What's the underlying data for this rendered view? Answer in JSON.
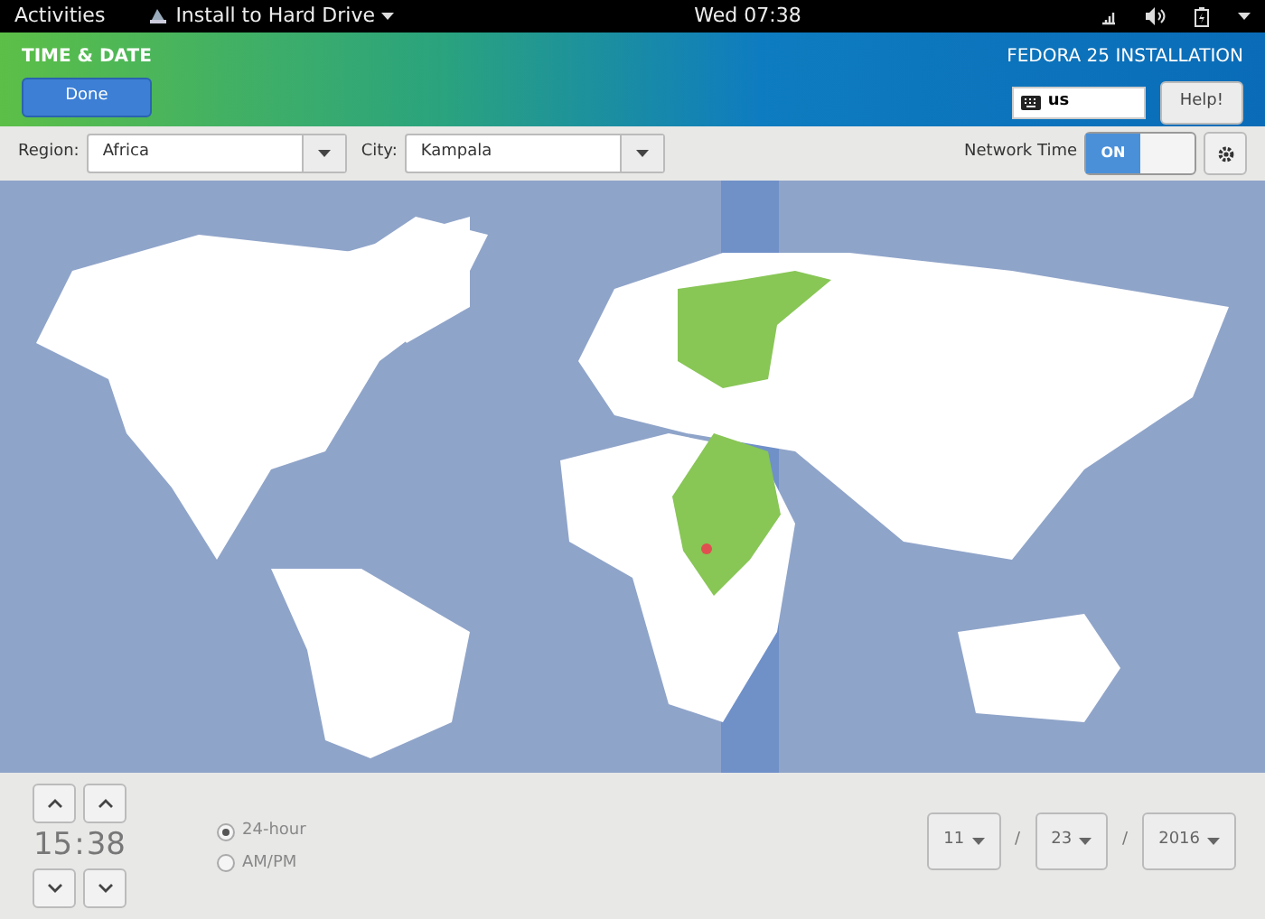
{
  "top_bar": {
    "activities": "Activities",
    "app_menu": "Install to Hard Drive",
    "clock": "Wed 07:38"
  },
  "header": {
    "title": "TIME & DATE",
    "done": "Done",
    "product": "FEDORA 25 INSTALLATION",
    "keyboard": "us",
    "help": "Help!"
  },
  "toolbar": {
    "region_label": "Region:",
    "region": "Africa",
    "city_label": "City:",
    "city": "Kampala",
    "network_time_label": "Network Time",
    "network_time": {
      "on": true,
      "label": "ON"
    }
  },
  "time": {
    "hours": "15",
    "separator": ":",
    "minutes": "38"
  },
  "time_format": [
    {
      "label": "24-hour",
      "selected": true
    },
    {
      "label": "AM/PM",
      "selected": false
    }
  ],
  "date": {
    "month": "11",
    "separator_1": "/",
    "day": "23",
    "separator_2": "/",
    "year": "2016"
  }
}
